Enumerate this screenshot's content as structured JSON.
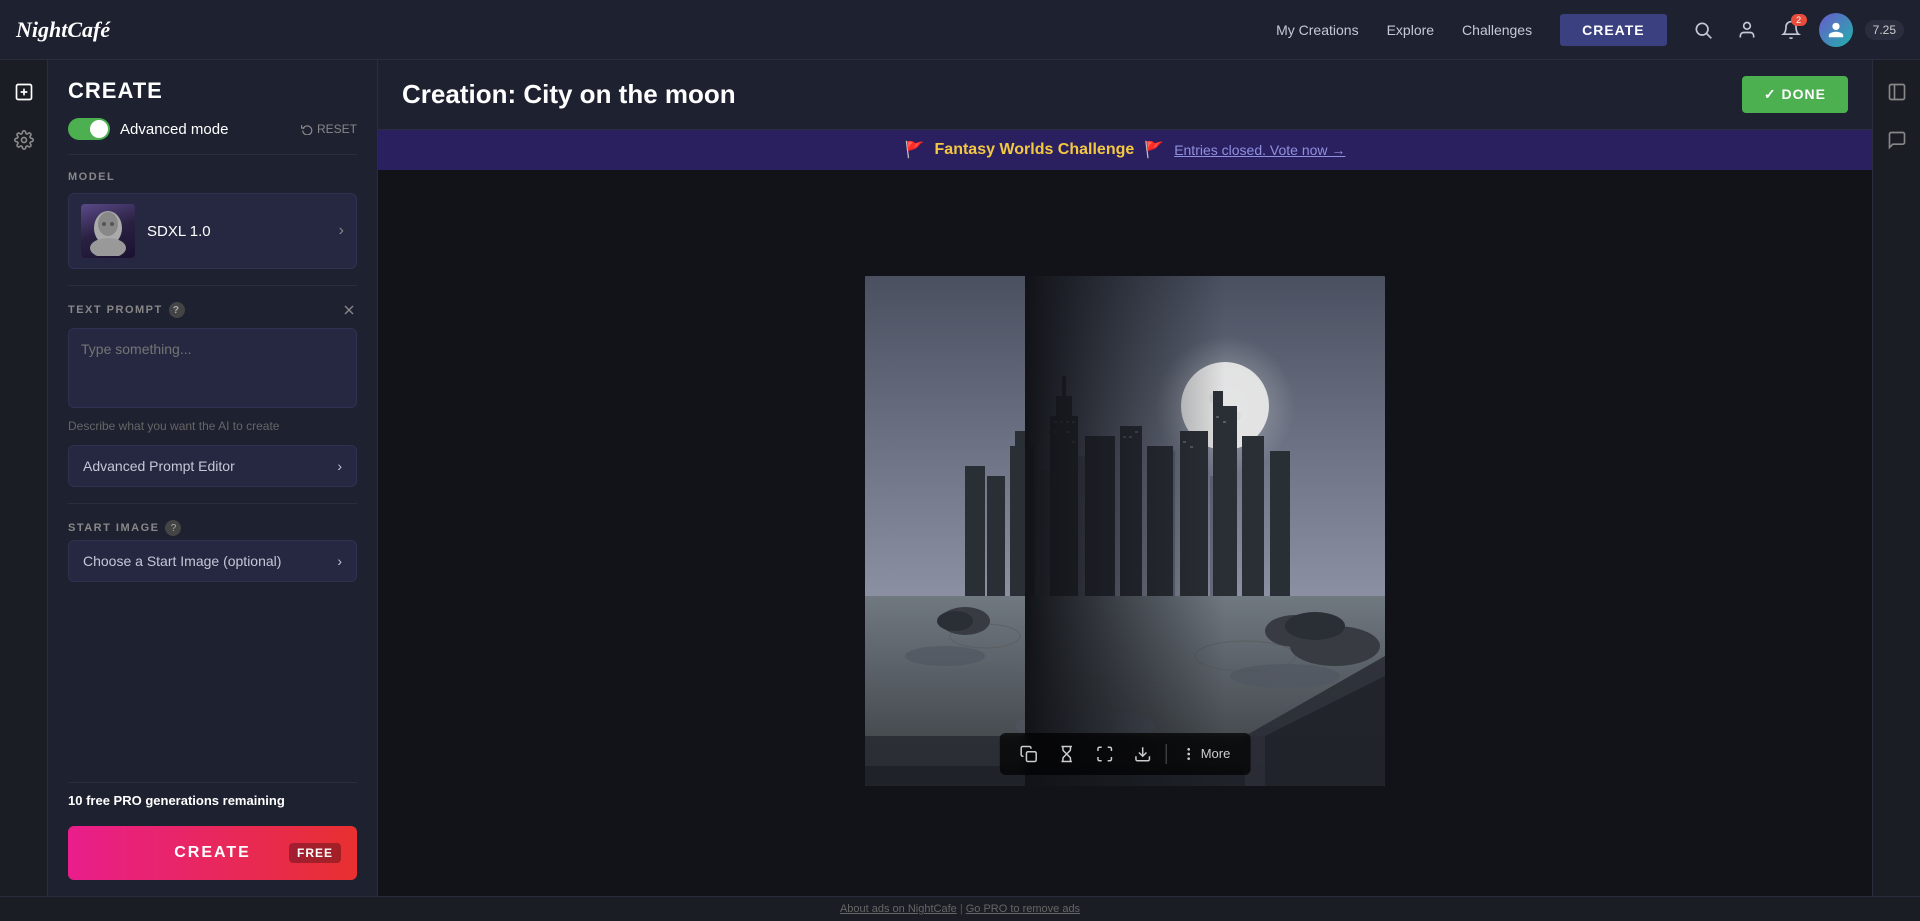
{
  "app": {
    "logo": "NightCafé",
    "title": "Creation: City on the moon"
  },
  "topnav": {
    "links": [
      {
        "label": "My Creations",
        "key": "my-creations"
      },
      {
        "label": "Explore",
        "key": "explore"
      },
      {
        "label": "Challenges",
        "key": "challenges"
      }
    ],
    "create_button": "CREATE",
    "notification_count": "2",
    "credits": "7.25"
  },
  "done_button": "✓  DONE",
  "challenge_banner": {
    "emoji_left": "🚩",
    "name": "Fantasy Worlds Challenge",
    "emoji_right": "🚩",
    "entries_link": "Entries closed. Vote now →"
  },
  "left_panel": {
    "header": "CREATE",
    "advanced_mode_label": "Advanced mode",
    "reset_label": "RESET",
    "model_section": "MODEL",
    "model_name": "SDXL 1.0",
    "text_prompt_section": "TEXT PROMPT",
    "text_prompt_placeholder": "Type something...",
    "text_prompt_hint": "Describe what you want the AI to create",
    "advanced_prompt_label": "Advanced Prompt Editor",
    "start_image_section": "START IMAGE",
    "start_image_label": "Choose a Start Image (optional)",
    "pro_remaining_count": "10",
    "pro_remaining_text": "free PRO generations remaining",
    "create_button": "CREATE",
    "free_badge": "FREE"
  },
  "image_toolbar": {
    "copy_icon": "⧉",
    "timer_icon": "⏳",
    "expand_icon": "⛶",
    "download_icon": "⬇",
    "more_label": "More"
  },
  "bottom_bar": {
    "about_ads": "About ads on NightCafe",
    "separator": "|",
    "go_pro": "Go PRO to remove ads"
  }
}
